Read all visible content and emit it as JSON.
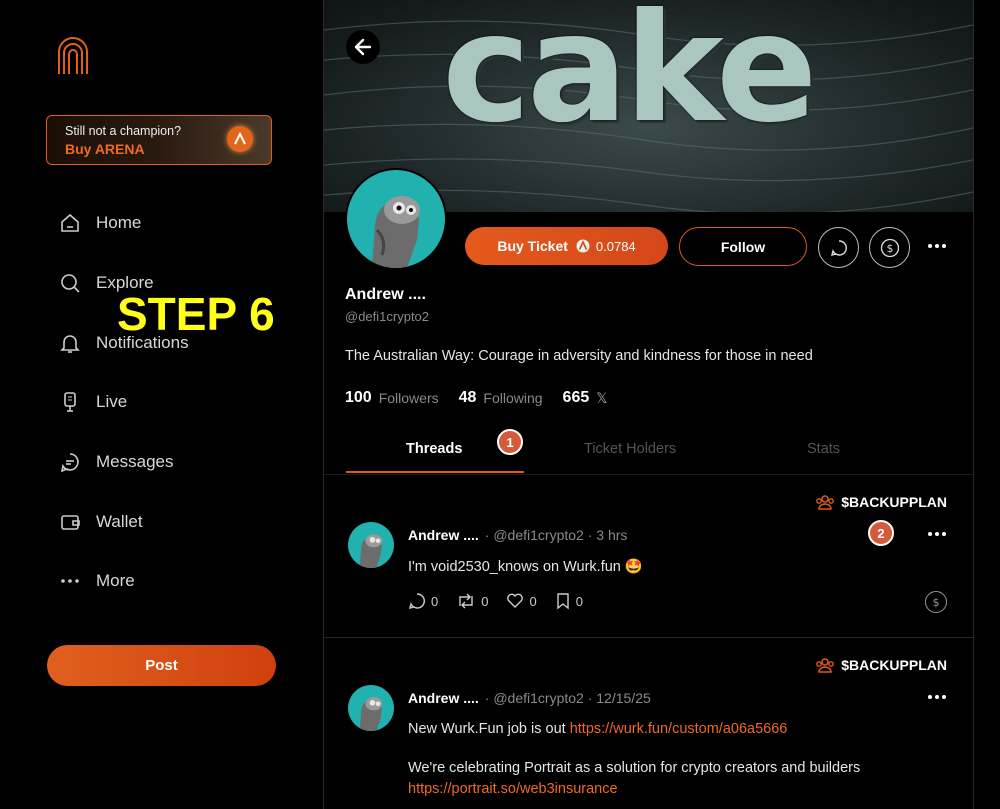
{
  "promo": {
    "line1": "Still not a champion?",
    "line2": "Buy ARENA"
  },
  "nav": [
    {
      "label": "Home",
      "icon": "home-icon"
    },
    {
      "label": "Explore",
      "icon": "search-icon"
    },
    {
      "label": "Notifications",
      "icon": "bell-icon"
    },
    {
      "label": "Live",
      "icon": "microphone-icon"
    },
    {
      "label": "Messages",
      "icon": "chat-bubble-icon"
    },
    {
      "label": "Wallet",
      "icon": "wallet-icon"
    },
    {
      "label": "More",
      "icon": "ellipsis-icon"
    }
  ],
  "overlay": {
    "step_label": "STEP 6"
  },
  "post_button": "Post",
  "banner": {
    "text": "cake"
  },
  "profile": {
    "buy_ticket_label": "Buy Ticket",
    "ticket_price": "0.0784",
    "follow_label": "Follow",
    "name": "Andrew ....",
    "handle": "@defi1crypto2",
    "bio": "The Australian Way: Courage in adversity and kindness for those in need",
    "followers_count": "100",
    "followers_label": "Followers",
    "following_count": "48",
    "following_label": "Following",
    "x_count": "665",
    "x_icon": "𝕏"
  },
  "tabs": [
    {
      "label": "Threads",
      "active": true
    },
    {
      "label": "Ticket Holders",
      "active": false
    },
    {
      "label": "Stats",
      "active": false
    }
  ],
  "markers": [
    "1",
    "2"
  ],
  "posts": [
    {
      "community": "$BACKUPPLAN",
      "author": "Andrew ....",
      "meta": "· @defi1crypto2 · 3 hrs",
      "text": "I'm void2530_knows on Wurk.fun 🤩",
      "replies": "0",
      "reposts": "0",
      "likes": "0",
      "bookmarks": "0"
    },
    {
      "community": "$BACKUPPLAN",
      "author": "Andrew ....",
      "meta": "· @defi1crypto2 · 12/15/25",
      "text_prefix": "New Wurk.Fun job is out ",
      "link1": "https://wurk.fun/custom/a06a5666",
      "text2": "We're celebrating Portrait as a solution for crypto creators and builders",
      "link2": "https://portrait.so/web3insurance"
    }
  ],
  "colors": {
    "accent": "#e45a1c",
    "overlay_text": "#ffff1a",
    "avatar_bg": "#21b2b0"
  }
}
